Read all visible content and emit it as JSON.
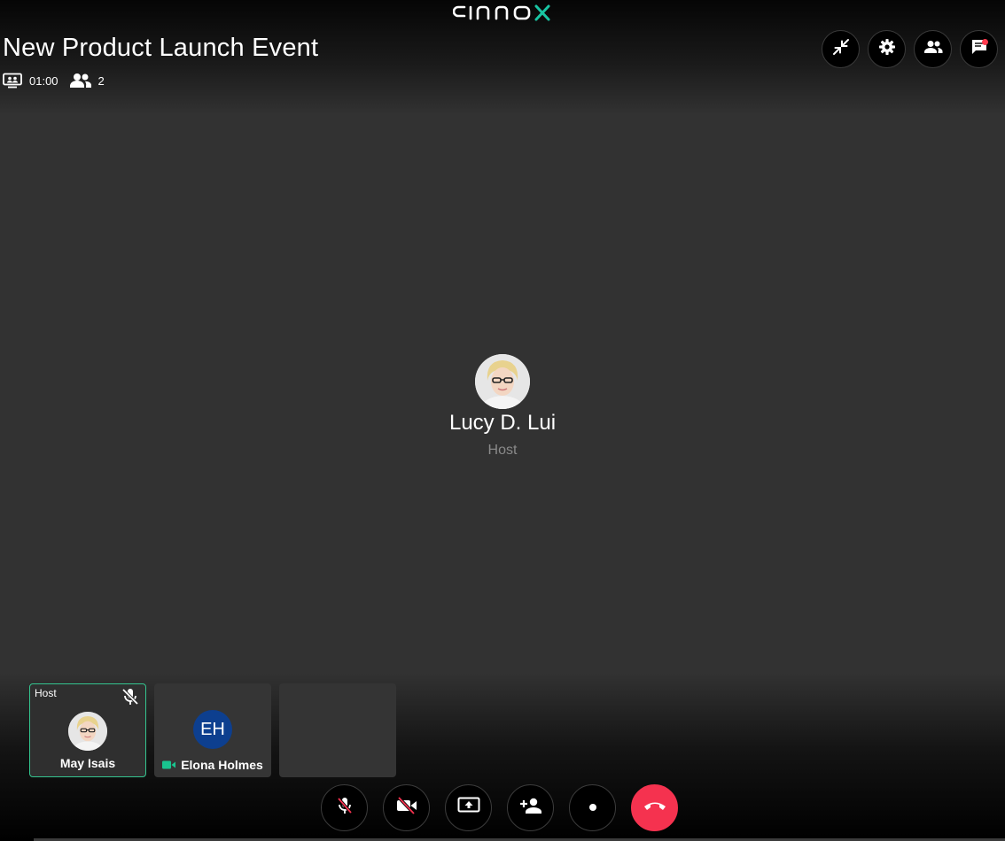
{
  "app": {
    "brand": "cinnox",
    "accent_color": "#19c5a3"
  },
  "meeting": {
    "title": "New Product Launch Event",
    "duration": "01:00",
    "participant_count": "2",
    "meeting_icon": "presentation-icon",
    "people_icon": "people-icon"
  },
  "top_controls": [
    {
      "name": "minimize-button",
      "icon": "collapse-arrows-icon"
    },
    {
      "name": "settings-button",
      "icon": "gear-icon"
    },
    {
      "name": "participants-button",
      "icon": "people-icon"
    },
    {
      "name": "chat-button",
      "icon": "chat-icon",
      "has_notification": true
    }
  ],
  "active_speaker": {
    "name": "Lucy D. Lui",
    "role": "Host"
  },
  "participants": [
    {
      "tag": "Host",
      "name": "May Isais",
      "muted": true,
      "active": true
    },
    {
      "initials": "EH",
      "name": "Elona Holmes",
      "video_on": true,
      "initials_color": "#0d3f8f"
    },
    {
      "empty": true
    }
  ],
  "call_controls": [
    {
      "name": "mute-button",
      "icon": "mic-off-icon"
    },
    {
      "name": "camera-button",
      "icon": "video-off-icon"
    },
    {
      "name": "share-screen-button",
      "icon": "screen-share-icon"
    },
    {
      "name": "add-participant-button",
      "icon": "add-person-icon"
    },
    {
      "name": "record-button",
      "icon": "record-dot-icon"
    },
    {
      "name": "hang-up-button",
      "icon": "phone-hangup-icon",
      "color": "#f5324f"
    }
  ]
}
